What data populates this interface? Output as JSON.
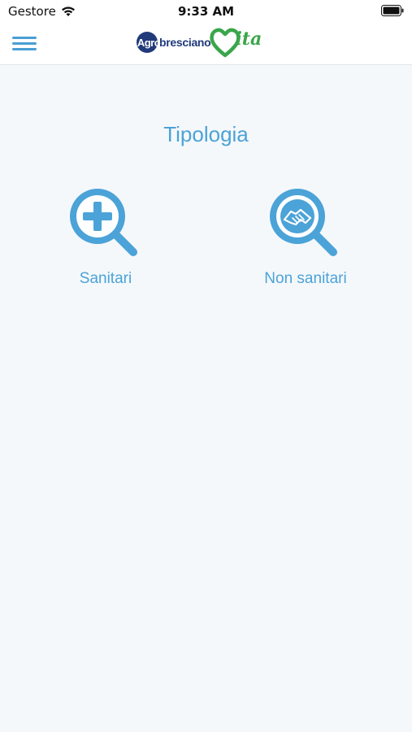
{
  "status_bar": {
    "carrier": "Gestore",
    "time": "9:33 AM"
  },
  "header": {
    "logo": {
      "agro": "Agro",
      "bresciano": "bresciano",
      "ita": "ita"
    }
  },
  "main": {
    "title": "Tipologia",
    "options": [
      {
        "label": "Sanitari",
        "icon": "medical-search-icon"
      },
      {
        "label": "Non sanitari",
        "icon": "handshake-search-icon"
      }
    ]
  },
  "colors": {
    "accent": "#4ba3d8",
    "brand_blue": "#213a7a",
    "brand_green": "#3aa64a",
    "background": "#f5f8fb"
  }
}
